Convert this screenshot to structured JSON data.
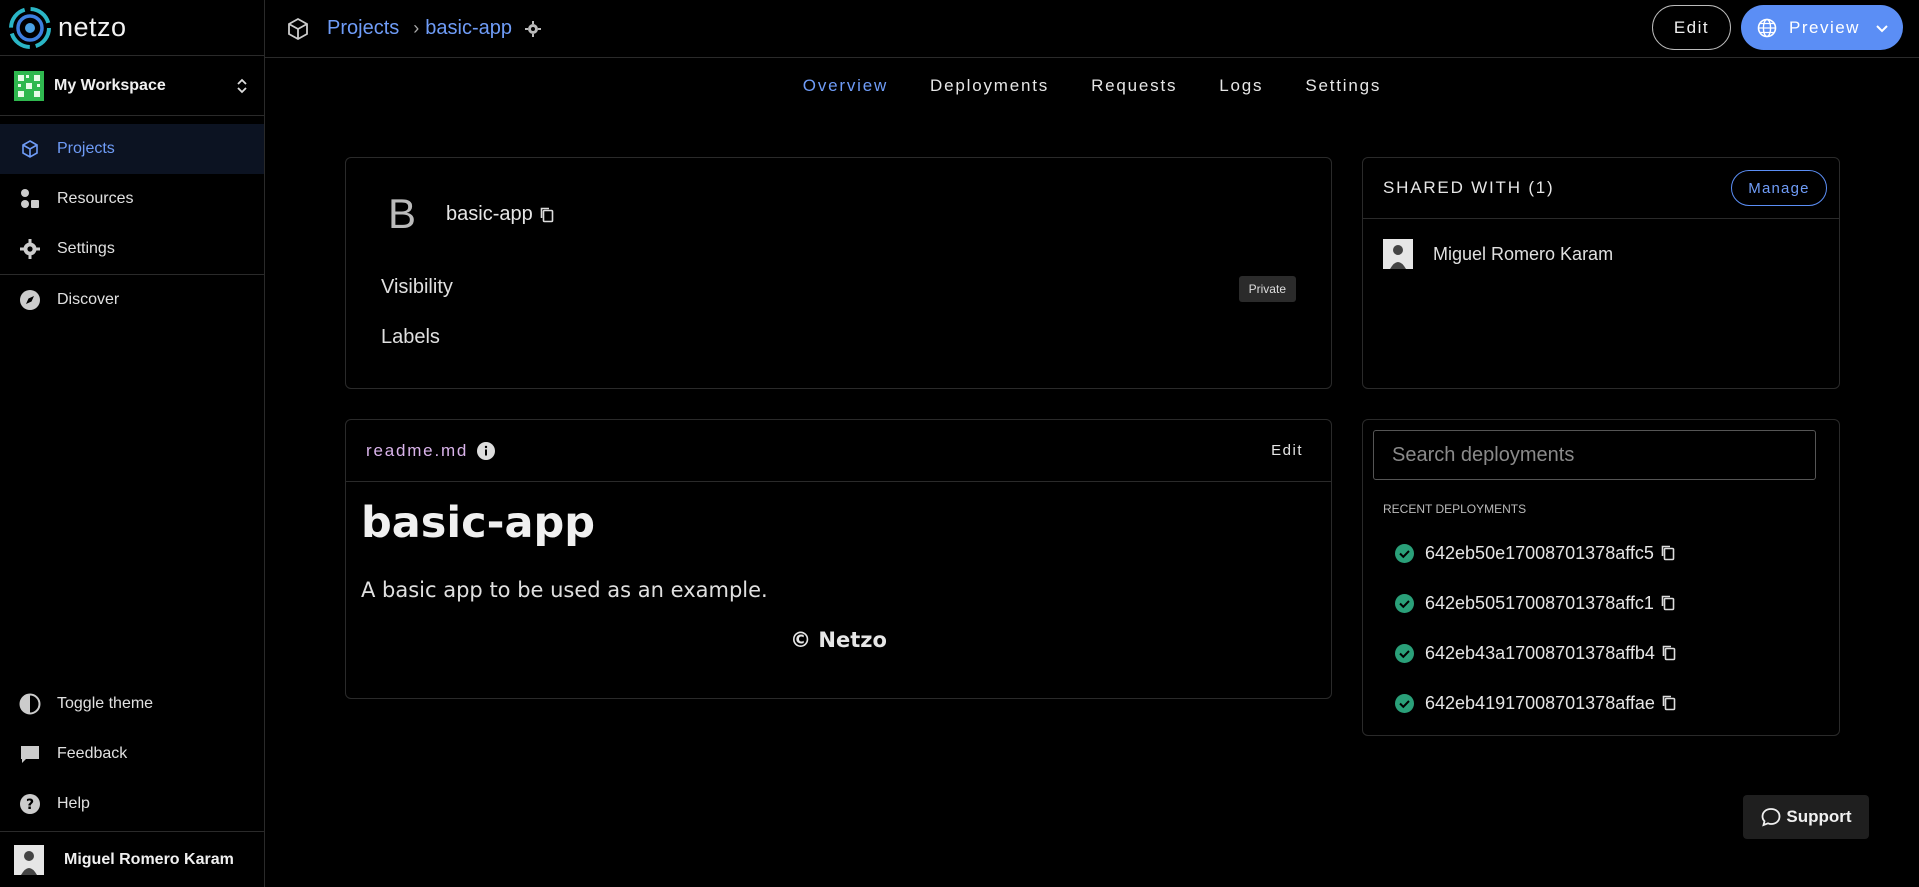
{
  "brand": {
    "name": "netzo"
  },
  "workspace": {
    "name": "My Workspace"
  },
  "sidebar": {
    "items": [
      {
        "label": "Projects",
        "icon": "cube-icon",
        "active": true
      },
      {
        "label": "Resources",
        "icon": "resources-icon"
      },
      {
        "label": "Settings",
        "icon": "gear-icon"
      },
      {
        "label": "Discover",
        "icon": "compass-icon"
      }
    ],
    "bottom_items": [
      {
        "label": "Toggle theme",
        "icon": "contrast-icon"
      },
      {
        "label": "Feedback",
        "icon": "chat-icon"
      },
      {
        "label": "Help",
        "icon": "help-icon"
      }
    ],
    "user": {
      "name": "Miguel Romero Karam"
    }
  },
  "header": {
    "breadcrumb": {
      "root": "Projects",
      "current": "basic-app"
    },
    "edit_label": "Edit",
    "preview_label": "Preview"
  },
  "tabs": [
    {
      "label": "Overview",
      "active": true
    },
    {
      "label": "Deployments"
    },
    {
      "label": "Requests"
    },
    {
      "label": "Logs"
    },
    {
      "label": "Settings"
    }
  ],
  "project": {
    "initial": "B",
    "name": "basic-app",
    "visibility_label": "Visibility",
    "visibility_value": "Private",
    "labels_label": "Labels"
  },
  "shared": {
    "title": "SHARED WITH (1)",
    "manage_label": "Manage",
    "users": [
      {
        "name": "Miguel Romero Karam"
      }
    ]
  },
  "readme": {
    "filename": "readme.md",
    "edit_label": "Edit",
    "heading": "basic-app",
    "paragraph": "A basic app to be used as an example.",
    "footer": "© Netzo"
  },
  "deployments": {
    "search_placeholder": "Search deployments",
    "recent_label": "RECENT DEPLOYMENTS",
    "items": [
      {
        "id": "642eb50e17008701378affc5",
        "status": "success"
      },
      {
        "id": "642eb50517008701378affc1",
        "status": "success"
      },
      {
        "id": "642eb43a17008701378affb4",
        "status": "success"
      },
      {
        "id": "642eb41917008701378affae",
        "status": "success"
      }
    ]
  },
  "support": {
    "label": "Support"
  },
  "colors": {
    "accent": "#5b8ef5",
    "link": "#6f9cf7",
    "success": "#2aa079",
    "readme_title": "#d9b3ea"
  }
}
